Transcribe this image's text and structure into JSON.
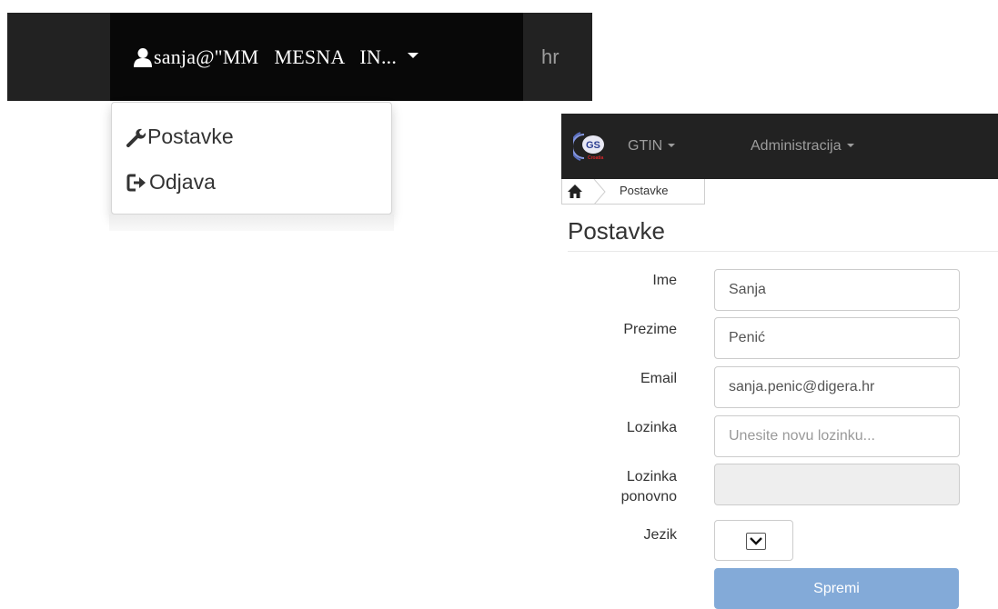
{
  "user_menu": {
    "user_label": "sanja@\"MM   MESNA   IN...",
    "language": "hr",
    "items": [
      {
        "label": "Postavke",
        "icon": "wrench-icon"
      },
      {
        "label": "Odjava",
        "icon": "logout-icon"
      }
    ]
  },
  "navbar": {
    "logo_text": "GS",
    "logo_subtext": "Croatia",
    "menu": [
      {
        "label": "GTIN"
      },
      {
        "label": "Administracija"
      }
    ]
  },
  "breadcrumb": {
    "current": "Postavke"
  },
  "page": {
    "title": "Postavke"
  },
  "form": {
    "ime": {
      "label": "Ime",
      "value": "Sanja"
    },
    "prezime": {
      "label": "Prezime",
      "value": "Penić"
    },
    "email": {
      "label": "Email",
      "value": "sanja.penic@digera.hr"
    },
    "lozinka": {
      "label": "Lozinka",
      "placeholder": "Unesite novu lozinku..."
    },
    "lozinka_ponovno": {
      "label_line1": "Lozinka",
      "label_line2": "ponovno"
    },
    "jezik": {
      "label": "Jezik"
    },
    "submit_label": "Spremi"
  },
  "colors": {
    "navbar": "#222222",
    "active_nav": "#080808",
    "button": "#83aad8",
    "logo_red": "#d9252b"
  }
}
